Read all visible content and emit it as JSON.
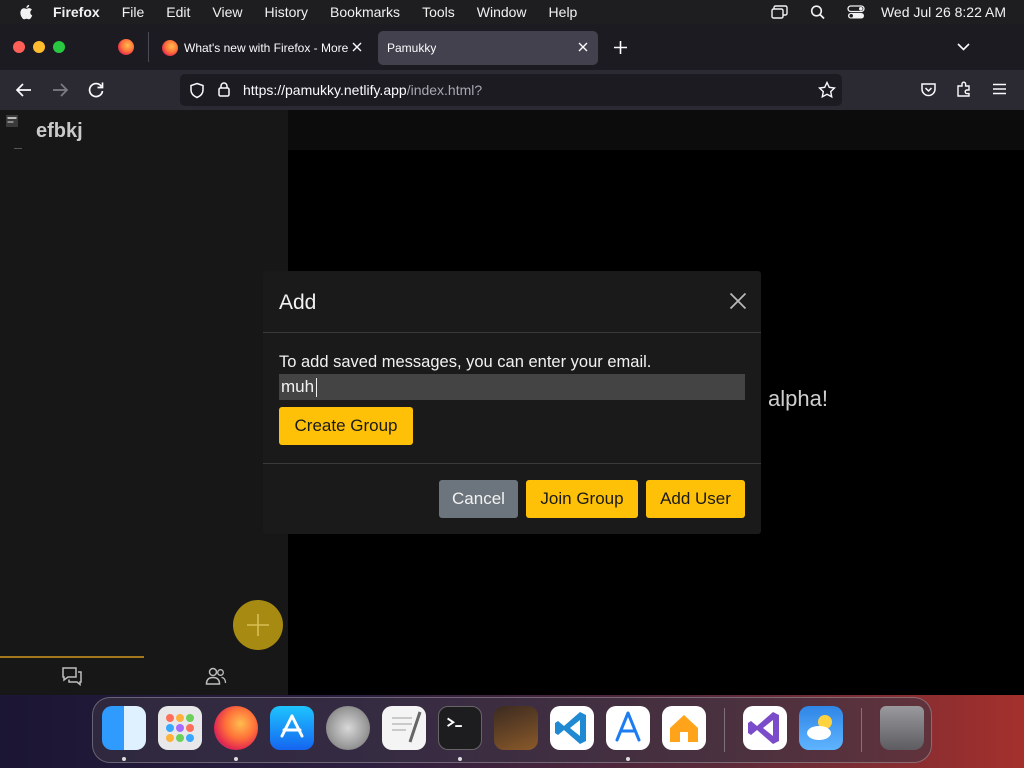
{
  "menubar": {
    "app_name": "Firefox",
    "items": [
      "File",
      "Edit",
      "View",
      "History",
      "Bookmarks",
      "Tools",
      "Window",
      "Help"
    ],
    "clock": "Wed Jul 26  8:22 AM"
  },
  "tabs": [
    {
      "title": "What's new with Firefox - More"
    },
    {
      "title": "Pamukky"
    }
  ],
  "url": {
    "host": "https://pamukky.netlify.app",
    "path": "/index.html?"
  },
  "sidebar": {
    "user_name": "efbkj"
  },
  "chat": {
    "welcome_text": "alpha!"
  },
  "modal": {
    "title": "Add",
    "instruction": "To add saved messages, you can enter your email.",
    "input_value": "muh",
    "create_group_label": "Create Group",
    "cancel_label": "Cancel",
    "join_group_label": "Join Group",
    "add_user_label": "Add User"
  },
  "colors": {
    "accent_yellow": "#ffc107",
    "cancel_gray": "#6c757d",
    "fab_dim": "#a68a12"
  },
  "dock": {
    "apps": [
      "finder-icon",
      "launchpad-icon",
      "firefox-icon",
      "app-store-icon",
      "system-settings-icon",
      "textedit-icon",
      "terminal-icon",
      "garageband-icon",
      "vscode-icon",
      "xcode-instruments-icon",
      "home-icon",
      "visual-studio-icon",
      "weather-icon",
      "trash-icon"
    ]
  }
}
